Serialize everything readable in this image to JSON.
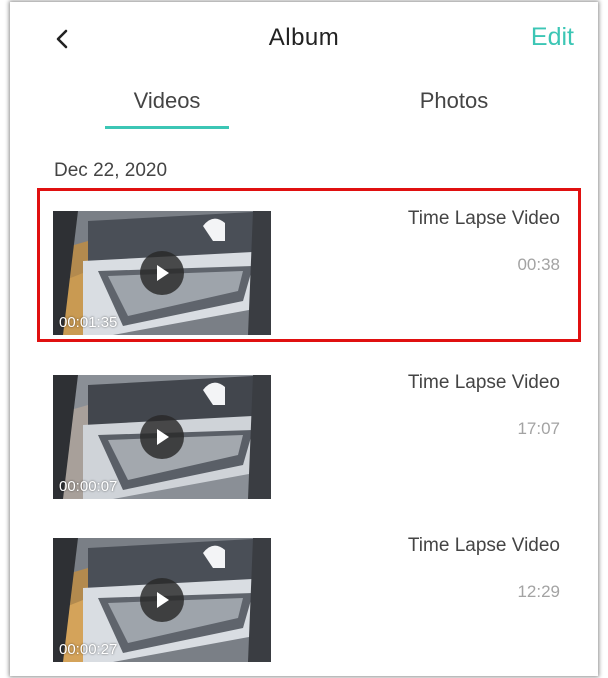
{
  "header": {
    "title": "Album",
    "edit_label": "Edit"
  },
  "tabs": [
    {
      "label": "Videos",
      "active": true
    },
    {
      "label": "Photos",
      "active": false
    }
  ],
  "sections": [
    {
      "date": "Dec 22, 2020",
      "items": [
        {
          "title": "Time Lapse Video",
          "time": "00:38",
          "duration": "00:01:35",
          "selected": true
        },
        {
          "title": "Time Lapse Video",
          "time": "17:07",
          "duration": "00:00:07",
          "selected": false
        },
        {
          "title": "Time Lapse Video",
          "time": "12:29",
          "duration": "00:00:27",
          "selected": false
        }
      ]
    }
  ],
  "colors": {
    "accent": "#3cc6b5",
    "highlight": "#e01010"
  },
  "icons": {
    "back": "chevron-left-icon",
    "play": "play-icon"
  }
}
